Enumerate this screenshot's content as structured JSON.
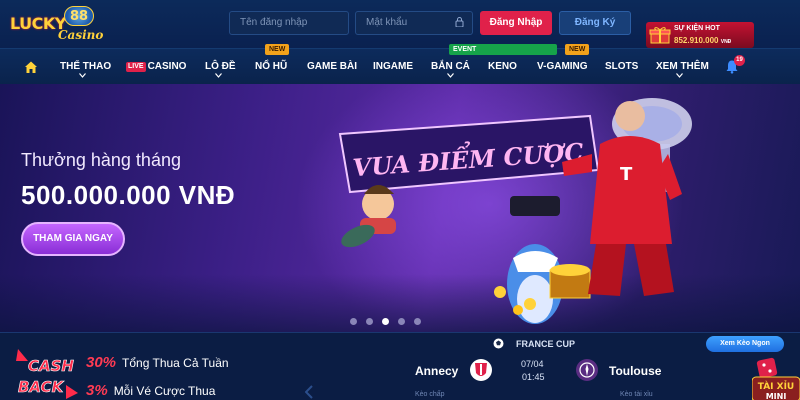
{
  "header": {
    "logo_text": "LUCKY",
    "logo_number": "88",
    "logo_subtext": "Casino",
    "username_placeholder": "Tên đăng nhập",
    "password_placeholder": "Mật khẩu",
    "login_label": "Đăng Nhập",
    "register_label": "Đăng Ký",
    "hot_event_label": "SỰ KIỆN HOT",
    "hot_event_value": "852.910.000",
    "hot_event_unit": "VNĐ"
  },
  "nav": {
    "items": [
      {
        "label": "THỂ THAO",
        "badge": ""
      },
      {
        "label": "CASINO",
        "badge": "",
        "live": "LIVE"
      },
      {
        "label": "LÔ ĐỀ",
        "badge": ""
      },
      {
        "label": "NỔ HŨ",
        "badge": "NEW"
      },
      {
        "label": "GAME BÀI",
        "badge": ""
      },
      {
        "label": "INGAME",
        "badge": ""
      },
      {
        "label": "BẮN CÁ",
        "badge": "EVENT"
      },
      {
        "label": "KENO",
        "badge": ""
      },
      {
        "label": "V-GAMING",
        "badge": "NEW"
      },
      {
        "label": "SLOTS",
        "badge": ""
      },
      {
        "label": "XEM THÊM",
        "badge": ""
      }
    ],
    "notification_count": "19"
  },
  "banner": {
    "subtitle": "Thưởng hàng tháng",
    "amount": "500.000.000 VNĐ",
    "cta_label": "THAM GIA NGAY",
    "headline_art": "VUA ĐIỂM CƯỢC",
    "slide_count": 5,
    "active_slide": 3
  },
  "cashback": {
    "logo_line1": "CASH",
    "logo_line2": "BACK",
    "row1_pct": "30%",
    "row1_text": "Tổng Thua Cả Tuần",
    "row2_pct": "3%",
    "row2_text": "Mỗi Vé Cược Thua"
  },
  "match": {
    "league": "FRANCE CUP",
    "home": "Annecy",
    "away": "Toulouse",
    "date": "07/04",
    "time": "01:45",
    "odds_left": "Kèo chấp",
    "odds_right": "Kèo tài xỉu",
    "more_odds": "Xem Kèo Ngon"
  },
  "taixiu": {
    "label_line1": "TÀI XỈU",
    "label_line2": "MINI"
  },
  "colors": {
    "accent": "#e0214a",
    "brand_gold": "#ffd23a",
    "nav_bg": "#0a234c",
    "banner_purple": "#5a2aa4"
  }
}
